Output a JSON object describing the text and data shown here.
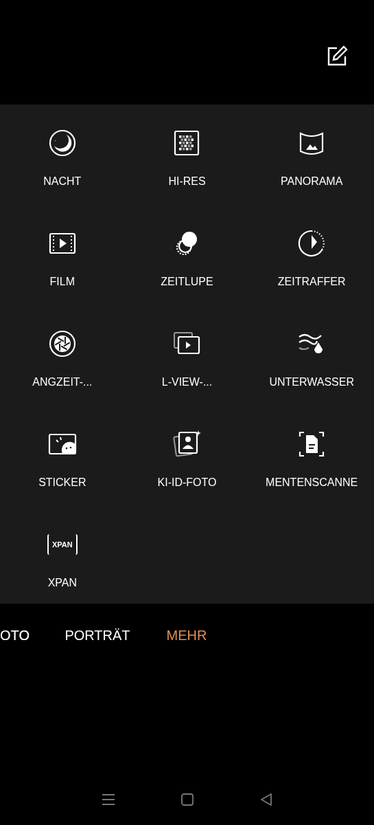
{
  "modes": [
    {
      "label": "NACHT"
    },
    {
      "label": "HI-RES"
    },
    {
      "label": "PANORAMA"
    },
    {
      "label": "FILM"
    },
    {
      "label": "ZEITLUPE"
    },
    {
      "label": "ZEITRAFFER"
    },
    {
      "label": "ANGZEIT-..."
    },
    {
      "label": "L-VIEW-..."
    },
    {
      "label": "UNTERWASSER"
    },
    {
      "label": "STICKER"
    },
    {
      "label": "KI-ID-FOTO"
    },
    {
      "label": "MENTENSCANNE"
    },
    {
      "label": "XPAN",
      "icon_text": "XPAN"
    }
  ],
  "mode_bar": [
    {
      "label": "OTO",
      "selected": false
    },
    {
      "label": "PORTRÄT",
      "selected": false
    },
    {
      "label": "MEHR",
      "selected": true
    }
  ]
}
